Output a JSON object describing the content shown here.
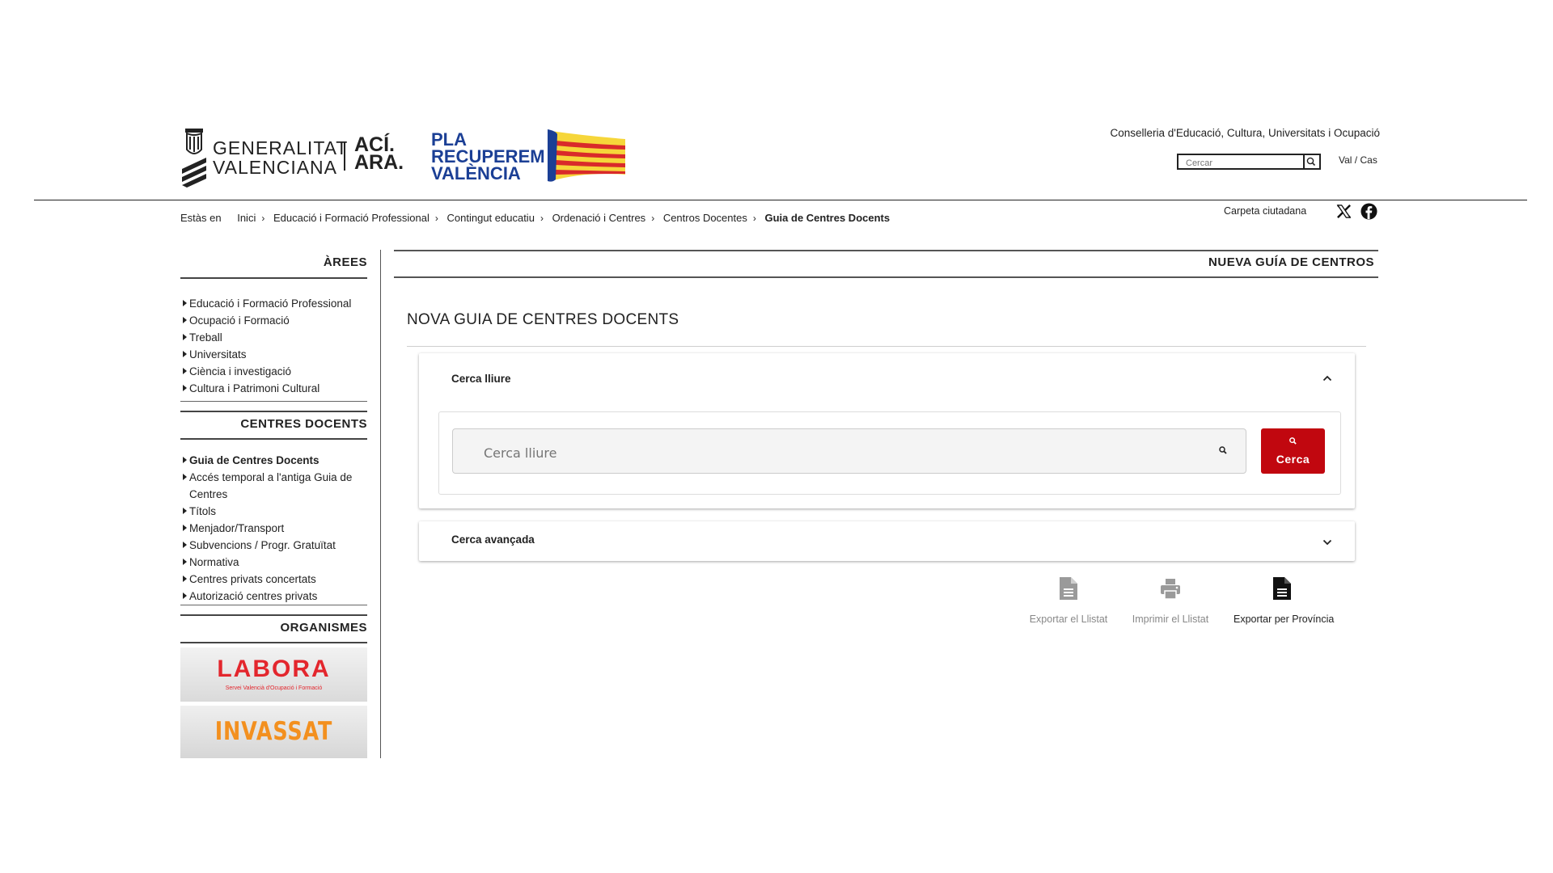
{
  "header": {
    "logo_line1": "GENERALITAT",
    "logo_line2": "VALENCIANA",
    "aci_line1": "ACÍ.",
    "aci_line2": "ARA.",
    "pla_line1": "PLA",
    "pla_line2": "RECUPEREM",
    "pla_line3": "VALÈNCIA",
    "conselleria": "Conselleria d'Educació, Cultura, Universitats i Ocupació",
    "search_placeholder": "Cercar",
    "lang_val": "Val",
    "lang_sep": "/",
    "lang_cas": "Cas",
    "carpeta": "Carpeta ciutadana"
  },
  "breadcrumb": {
    "lead": "Estàs en",
    "items": [
      "Inici",
      "Educació i Formació Professional",
      "Contingut educatiu",
      "Ordenació i Centres",
      "Centros Docentes",
      "Guia de Centres Docents"
    ]
  },
  "sidebar": {
    "areas_title": "ÀREES",
    "areas": [
      "Educació i Formació Professional",
      "Ocupació i Formació",
      "Treball",
      "Universitats",
      "Ciència i investigació",
      "Cultura i Patrimoni Cultural"
    ],
    "centres_title": "CENTRES DOCENTS",
    "centres": [
      "Guia de Centres Docents",
      "Accés temporal a l'antiga Guia de Centres",
      "Títols",
      "Menjador/Transport",
      "Subvencions / Progr. Gratuïtat",
      "Normativa",
      "Centres privats concertats",
      "Autorizació centres privats"
    ],
    "organismes_title": "ORGANISMES",
    "labora_name": "LABORA",
    "labora_sub": "Servei Valencià d'Ocupació i Formació",
    "invassat_name": "INVASSAT"
  },
  "main": {
    "section_head": "NUEVA GUÍA DE CENTROS",
    "page_title": "NOVA GUIA DE CENTRES DOCENTS",
    "panel1_title": "Cerca lliure",
    "search_placeholder": "Cerca lliure",
    "search_button": "Cerca",
    "panel2_title": "Cerca avançada",
    "actions": {
      "export_list": "Exportar el Llistat",
      "print_list": "Imprimir el Llistat",
      "export_province": "Exportar per Província"
    }
  },
  "colors": {
    "brand_red": "#c1070f",
    "pla_blue": "#1b3f95",
    "labora_red": "#e3262d",
    "invassat_orange": "#f3901f"
  }
}
